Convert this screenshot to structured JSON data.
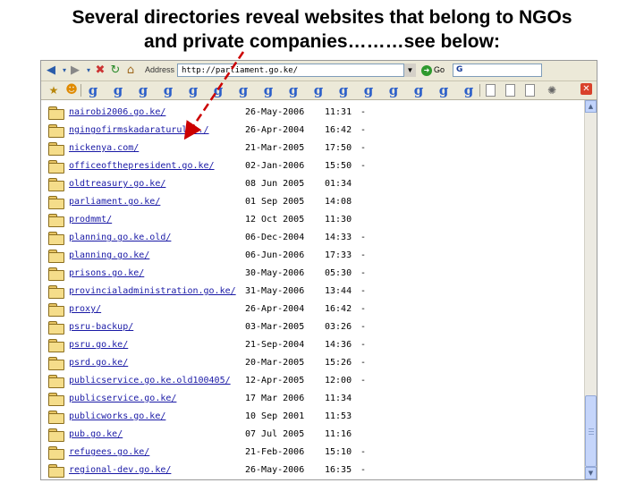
{
  "slide": {
    "title_line1": "Several directories reveal websites that belong to NGOs",
    "title_line2": "and private companies………see below:"
  },
  "browser": {
    "address_label": "Address",
    "address_value": "http://parliament.go.ke/",
    "go_label": "Go",
    "search_value": "G"
  },
  "toolbar_icons": [
    "back-icon",
    "forward-icon",
    "stop-icon",
    "refresh-icon",
    "home-icon",
    "search-icon",
    "favorites-icon",
    "history-icon"
  ],
  "links_bar": {
    "google_glyph": "g",
    "close_glyph": "✕"
  },
  "listing": {
    "rows": [
      {
        "name": "nairobi2006.go.ke/",
        "date": "26-May-2006",
        "time": "11:31",
        "size": "-"
      },
      {
        "name": "ngingofirmskadaraturul.../",
        "date": "26-Apr-2004",
        "time": "16:42",
        "size": "-"
      },
      {
        "name": "nickenya.com/",
        "date": "21-Mar-2005",
        "time": "17:50",
        "size": "-"
      },
      {
        "name": "officeofthepresident.go.ke/",
        "date": "02-Jan-2006",
        "time": "15:50",
        "size": "-"
      },
      {
        "name": "oldtreasury.go.ke/",
        "date": "08 Jun 2005",
        "time": "01:34",
        "size": ""
      },
      {
        "name": "parliament.go.ke/",
        "date": "01 Sep 2005",
        "time": "14:08",
        "size": ""
      },
      {
        "name": "prodmmt/",
        "date": "12 Oct 2005",
        "time": "11:30",
        "size": ""
      },
      {
        "name": "planning.go.ke.old/",
        "date": "06-Dec-2004",
        "time": "14:33",
        "size": "-"
      },
      {
        "name": "planning.go.ke/",
        "date": "06-Jun-2006",
        "time": "17:33",
        "size": "-"
      },
      {
        "name": "prisons.go.ke/",
        "date": "30-May-2006",
        "time": "05:30",
        "size": "-"
      },
      {
        "name": "provincialadministration.go.ke/",
        "date": "31-May-2006",
        "time": "13:44",
        "size": "-"
      },
      {
        "name": "proxy/",
        "date": "26-Apr-2004",
        "time": "16:42",
        "size": "-"
      },
      {
        "name": "psru-backup/",
        "date": "03-Mar-2005",
        "time": "03:26",
        "size": "-"
      },
      {
        "name": "psru.go.ke/",
        "date": "21-Sep-2004",
        "time": "14:36",
        "size": "-"
      },
      {
        "name": "psrd.go.ke/",
        "date": "20-Mar-2005",
        "time": "15:26",
        "size": "-"
      },
      {
        "name": "publicservice.go.ke.old100405/",
        "date": "12-Apr-2005",
        "time": "12:00",
        "size": "-"
      },
      {
        "name": "publicservice.go.ke/",
        "date": "17 Mar 2006",
        "time": "11:34",
        "size": ""
      },
      {
        "name": "publicworks.go.ke/",
        "date": "10 Sep 2001",
        "time": "11:53",
        "size": ""
      },
      {
        "name": "pub.go.ke/",
        "date": "07 Jul 2005",
        "time": "11:16",
        "size": ""
      },
      {
        "name": "refugees.go.ke/",
        "date": "21-Feb-2006",
        "time": "15:10",
        "size": "-"
      },
      {
        "name": "regional-dev.go.ke/",
        "date": "26-May-2006",
        "time": "16:35",
        "size": "-"
      }
    ]
  },
  "colors": {
    "link": "#1a1aa6",
    "arrow": "#cc0000",
    "toolbar": "#ece9d8"
  }
}
